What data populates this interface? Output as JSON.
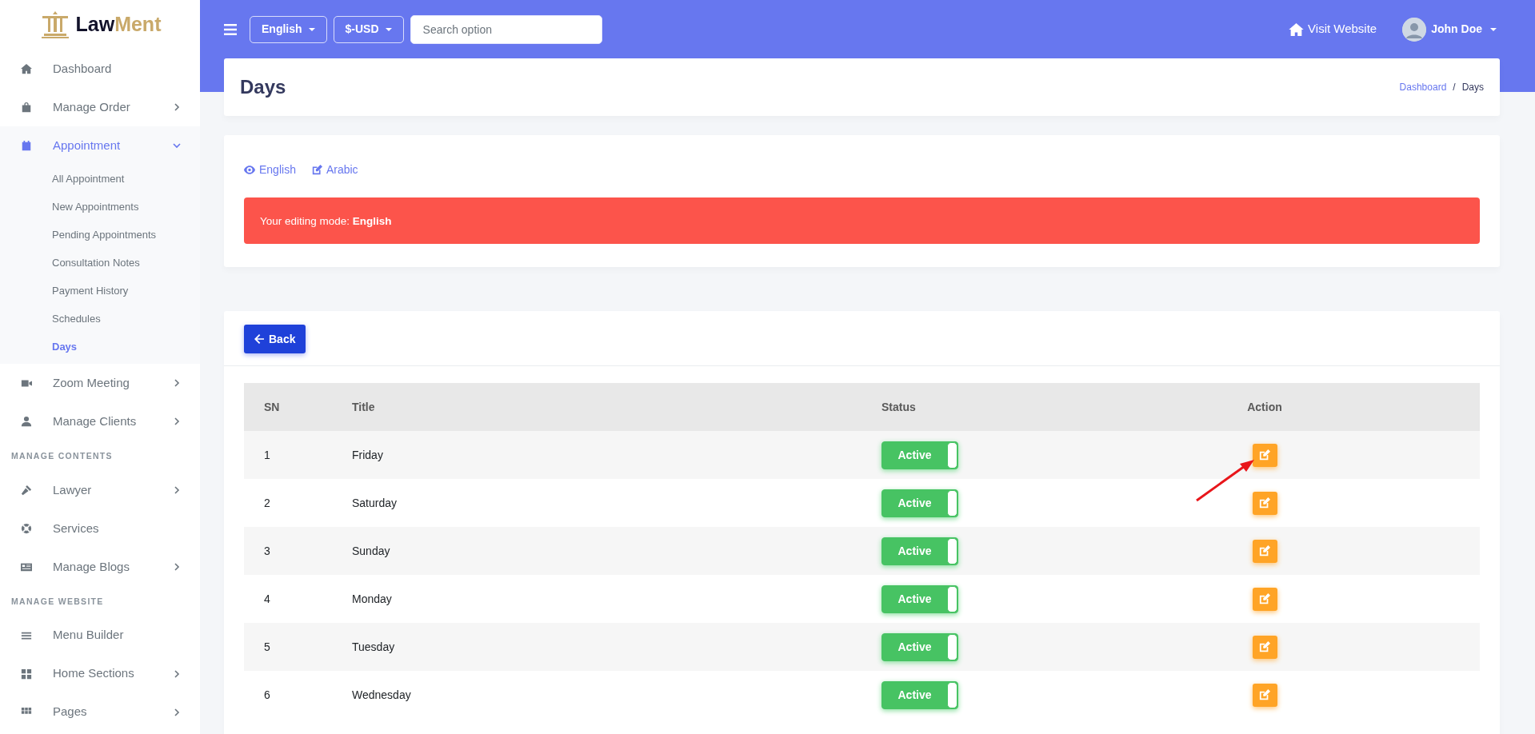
{
  "logo": {
    "text": "Law",
    "accent": "Ment"
  },
  "sidebar": {
    "items": [
      {
        "kind": "link",
        "label": "Dashboard",
        "selected": false
      },
      {
        "kind": "link",
        "label": "Manage Order",
        "expanded": false,
        "selected": false
      },
      {
        "kind": "link",
        "label": "Appointment",
        "expanded": true,
        "selected": true,
        "children": [
          {
            "label": "All Appointment",
            "selected": false
          },
          {
            "label": "New Appointments",
            "selected": false
          },
          {
            "label": "Pending Appointments",
            "selected": false
          },
          {
            "label": "Consultation Notes",
            "selected": false
          },
          {
            "label": "Payment History",
            "selected": false
          },
          {
            "label": "Schedules",
            "selected": false
          },
          {
            "label": "Days",
            "selected": true
          }
        ]
      },
      {
        "kind": "link",
        "label": "Zoom Meeting",
        "expanded": false,
        "selected": false
      },
      {
        "kind": "link",
        "label": "Manage Clients",
        "expanded": false,
        "selected": false
      },
      {
        "kind": "section",
        "label": "MANAGE CONTENTS"
      },
      {
        "kind": "link",
        "label": "Lawyer",
        "expanded": false,
        "selected": false
      },
      {
        "kind": "link",
        "label": "Services",
        "selected": false
      },
      {
        "kind": "link",
        "label": "Manage Blogs",
        "expanded": false,
        "selected": false
      },
      {
        "kind": "section",
        "label": "MANAGE WEBSITE"
      },
      {
        "kind": "link",
        "label": "Menu Builder",
        "selected": false
      },
      {
        "kind": "link",
        "label": "Home Sections",
        "expanded": false,
        "selected": false
      },
      {
        "kind": "link",
        "label": "Pages",
        "expanded": false,
        "selected": false
      }
    ]
  },
  "topbar": {
    "language": "English",
    "currency": "$-USD",
    "search": {
      "placeholder": "Search option"
    },
    "visit_website": "Visit Website",
    "user": "John Doe"
  },
  "page_header": {
    "title": "Days",
    "breadcrumb": [
      "Dashboard",
      "Days"
    ],
    "breadcrumb_separator": "/"
  },
  "language_tabs": [
    {
      "kind": "view",
      "label": "English"
    },
    {
      "kind": "edit",
      "label": "Arabic"
    }
  ],
  "alert": "Your editing mode: **English**",
  "back_button": "Back",
  "table": {
    "columns": [
      "SN",
      "Title",
      "Status",
      "Action"
    ],
    "rows": [
      {
        "sn": "1",
        "title": "Friday",
        "status": "Active",
        "active": true
      },
      {
        "sn": "2",
        "title": "Saturday",
        "status": "Active",
        "active": true
      },
      {
        "sn": "3",
        "title": "Sunday",
        "status": "Active",
        "active": true
      },
      {
        "sn": "4",
        "title": "Monday",
        "status": "Active",
        "active": true
      },
      {
        "sn": "5",
        "title": "Tuesday",
        "status": "Active",
        "active": true
      },
      {
        "sn": "6",
        "title": "Wednesday",
        "status": "Active",
        "active": true
      }
    ]
  }
}
